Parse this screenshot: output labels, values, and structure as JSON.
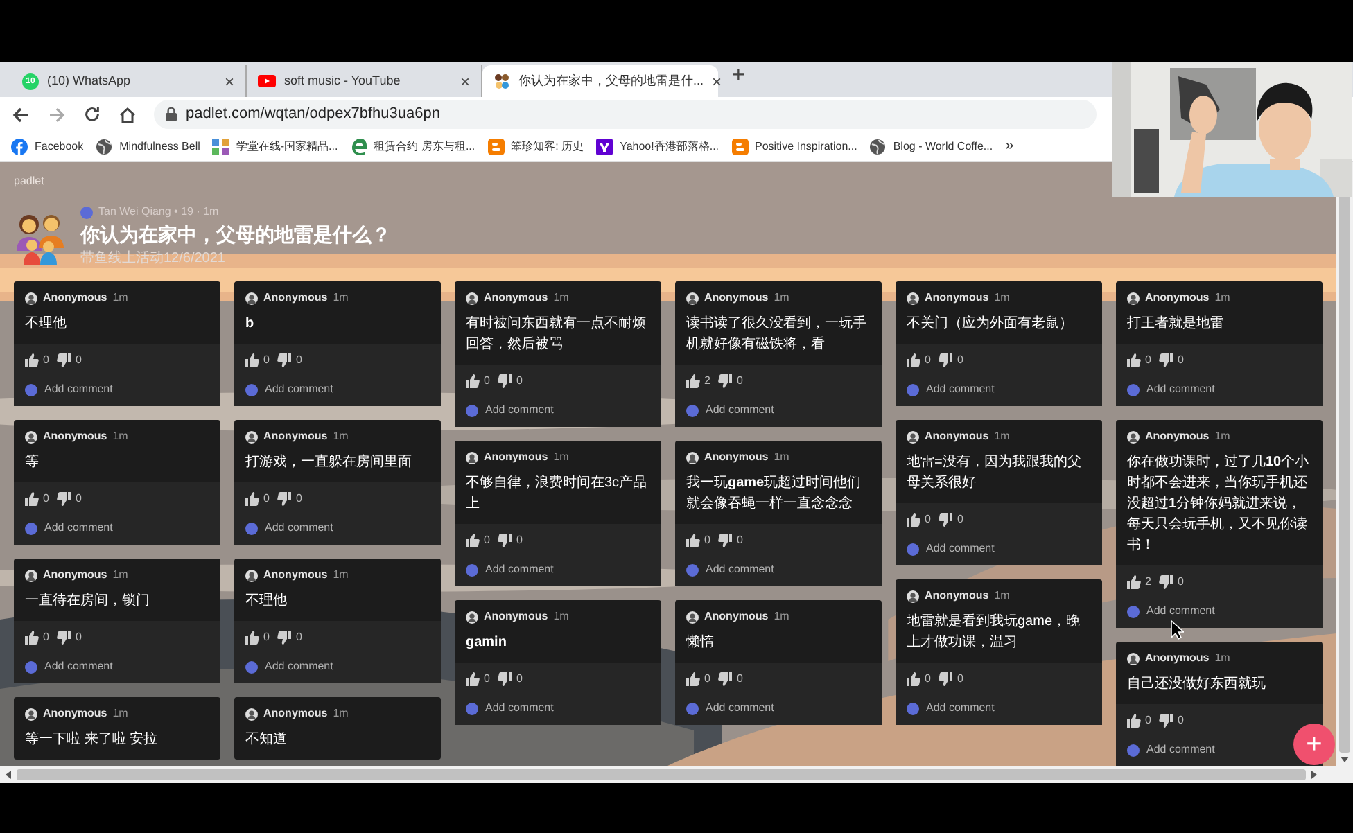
{
  "browser": {
    "tabs": [
      {
        "kind": "whatsapp",
        "badge": "10",
        "title": "(10) WhatsApp",
        "close": "×",
        "selected": false
      },
      {
        "kind": "youtube",
        "title": "soft music - YouTube",
        "close": "×",
        "selected": false
      },
      {
        "kind": "family",
        "title": "你认为在家中，父母的地雷是什...",
        "close": "×",
        "selected": true
      }
    ],
    "new_tab": "+",
    "address": "padlet.com/wqtan/odpex7bfhu3ua6pn",
    "bookmarks": [
      {
        "kind": "facebook",
        "label": "Facebook"
      },
      {
        "kind": "globe",
        "label": "Mindfulness Bell"
      },
      {
        "kind": "grid",
        "label": "学堂在线-国家精品..."
      },
      {
        "kind": "edge",
        "label": "租赁合约 房东与租..."
      },
      {
        "kind": "blogger",
        "label": "笨珍知客: 历史"
      },
      {
        "kind": "yahoo",
        "label": "Yahoo!香港部落格..."
      },
      {
        "kind": "blogger",
        "label": "Positive Inspiration..."
      },
      {
        "kind": "globe",
        "label": "Blog - World Coffe..."
      }
    ],
    "more": "»"
  },
  "padlet": {
    "brand": "padlet",
    "author": "Tan Wei Qiang • 19 · 1m",
    "title": "你认为在家中，父母的地雷是什么？",
    "subtitle": "带鱼线上活动12/6/2021"
  },
  "columns": [
    {
      "posts": [
        {
          "author": "Anonymous",
          "time": "1m",
          "text": "不理他",
          "likes": "0",
          "dislikes": "0",
          "comment": "Add comment"
        },
        {
          "author": "Anonymous",
          "time": "1m",
          "text": "等",
          "likes": "0",
          "dislikes": "0",
          "comment": "Add comment"
        },
        {
          "author": "Anonymous",
          "time": "1m",
          "text": "一直待在房间，锁门",
          "likes": "0",
          "dislikes": "0",
          "comment": "Add comment"
        },
        {
          "author": "Anonymous",
          "time": "1m",
          "text": "等一下啦 来了啦 安拉"
        }
      ]
    },
    {
      "posts": [
        {
          "author": "Anonymous",
          "time": "1m",
          "text": "**b**",
          "likes": "0",
          "dislikes": "0",
          "comment": "Add comment"
        },
        {
          "author": "Anonymous",
          "time": "1m",
          "text": "打游戏，一直躲在房间里面",
          "likes": "0",
          "dislikes": "0",
          "comment": "Add comment"
        },
        {
          "author": "Anonymous",
          "time": "1m",
          "text": "不理他",
          "likes": "0",
          "dislikes": "0",
          "comment": "Add comment"
        },
        {
          "author": "Anonymous",
          "time": "1m",
          "text": "不知道"
        }
      ]
    },
    {
      "posts": [
        {
          "author": "Anonymous",
          "time": "1m",
          "text": "有时被问东西就有一点不耐烦回答，然后被骂",
          "likes": "0",
          "dislikes": "0",
          "comment": "Add comment"
        },
        {
          "author": "Anonymous",
          "time": "1m",
          "text": "不够自律，浪费时间在3c产品上",
          "likes": "0",
          "dislikes": "0",
          "comment": "Add comment"
        },
        {
          "author": "Anonymous",
          "time": "1m",
          "text": "**gamin**",
          "likes": "0",
          "dislikes": "0",
          "comment": "Add comment"
        }
      ]
    },
    {
      "posts": [
        {
          "author": "Anonymous",
          "time": "1m",
          "text": "读书读了很久没看到，一玩手机就好像有磁铁将，看",
          "likes": "2",
          "dislikes": "0",
          "comment": "Add comment"
        },
        {
          "author": "Anonymous",
          "time": "1m",
          "text": "我一玩**game**玩超过时间他们就会像吞蝇一样一直念念念",
          "likes": "0",
          "dislikes": "0",
          "comment": "Add comment"
        },
        {
          "author": "Anonymous",
          "time": "1m",
          "text": "懒惰",
          "likes": "0",
          "dislikes": "0",
          "comment": "Add comment"
        }
      ]
    },
    {
      "posts": [
        {
          "author": "Anonymous",
          "time": "1m",
          "text": "不关门（应为外面有老鼠）",
          "likes": "0",
          "dislikes": "0",
          "comment": "Add comment"
        },
        {
          "author": "Anonymous",
          "time": "1m",
          "text": "地雷=没有，因为我跟我的父母关系很好",
          "likes": "0",
          "dislikes": "0",
          "comment": "Add comment"
        },
        {
          "author": "Anonymous",
          "time": "1m",
          "text": "地雷就是看到我玩game，晚上才做功课，温习",
          "likes": "0",
          "dislikes": "0",
          "comment": "Add comment"
        }
      ]
    },
    {
      "posts": [
        {
          "author": "Anonymous",
          "time": "1m",
          "text": "打王者就是地雷",
          "likes": "0",
          "dislikes": "0",
          "comment": "Add comment"
        },
        {
          "author": "Anonymous",
          "time": "1m",
          "text": "你在做功课时，过了几**10**个小时都不会进来，当你玩手机还没超过**1**分钟你妈就进来说，每天只会玩手机，又不见你读书！",
          "likes": "2",
          "dislikes": "0",
          "comment": "Add comment"
        },
        {
          "author": "Anonymous",
          "time": "1m",
          "text": "自己还没做好东西就玩",
          "likes": "0",
          "dislikes": "0",
          "comment": "Add comment"
        }
      ]
    }
  ],
  "fab": "+"
}
